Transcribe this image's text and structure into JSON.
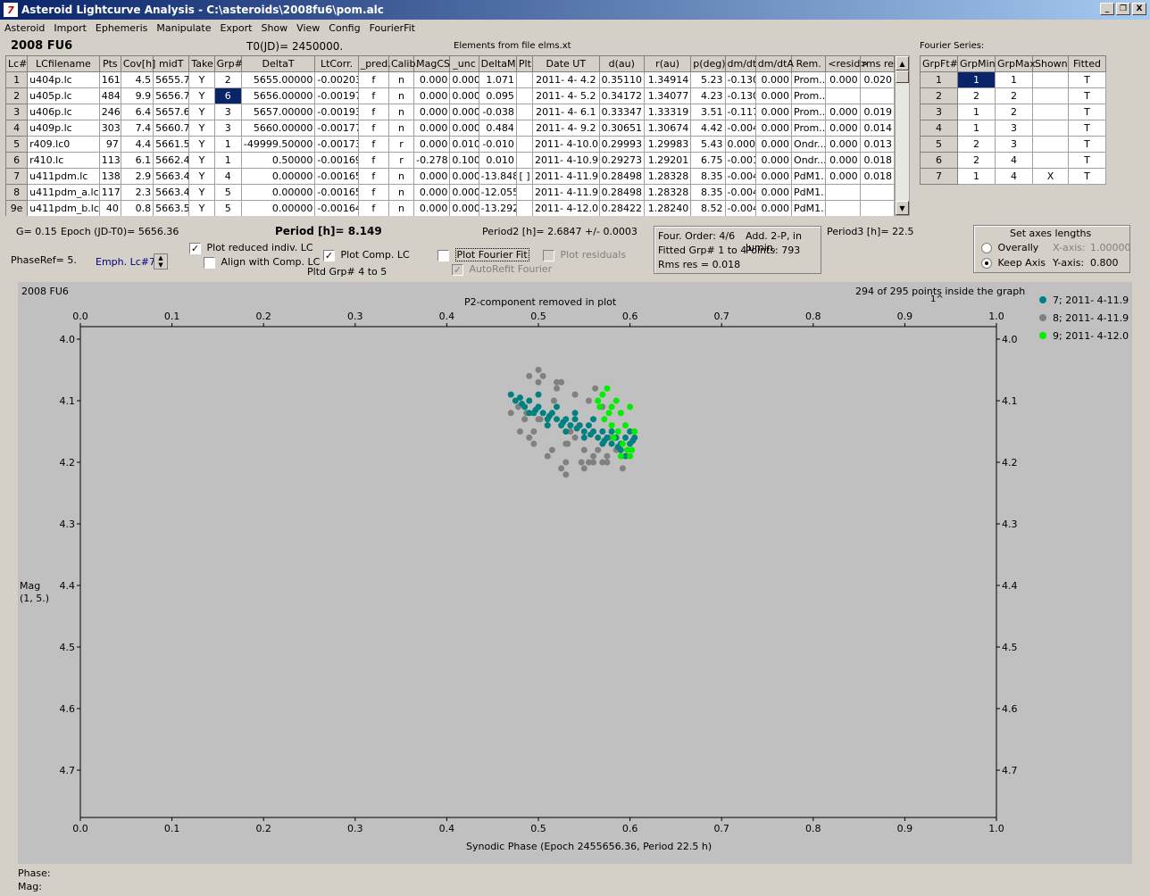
{
  "window": {
    "title": "Asteroid Lightcurve Analysis - C:\\asteroids\\2008fu6\\pom.alc",
    "icon_label": "7",
    "btn_min": "_",
    "btn_restore": "❐",
    "btn_close": "X"
  },
  "menu": [
    "Asteroid",
    "Import",
    "Ephemeris",
    "Manipulate",
    "Export",
    "Show",
    "View",
    "Config",
    "FourierFit"
  ],
  "header": {
    "asteroid": "2008 FU6",
    "t0": "T0(JD)= 2450000.",
    "elements": "Elements from file elms.xt",
    "fourier_series": "Fourier Series:"
  },
  "lc_table": {
    "columns": [
      "Lc#",
      "LCfilename",
      "Pts",
      "Cov[h]",
      "midT",
      "Take",
      "Grp#",
      "DeltaT",
      "LtCorr.",
      "_pred.",
      "Calib.",
      "MagCS",
      "_unc",
      "DeltaM",
      "Plt",
      "Date UT",
      "d(au)",
      "r(au)",
      "p(deg)",
      "dm/dt",
      "dm/dtA",
      "Rem.",
      "<resid>",
      "rms res"
    ],
    "rows": [
      [
        "1",
        "u404p.lc",
        "161",
        "4.5",
        "5655.7",
        "Y",
        "2",
        "5655.00000",
        "-0.00203",
        "f",
        "n",
        "0.000",
        "0.000",
        "1.071",
        "",
        "2011- 4- 4.2",
        "0.35110",
        "1.34914",
        "5.23",
        "-0.130",
        "0.000",
        "Prom...",
        "0.000",
        "0.020"
      ],
      [
        "2",
        "u405p.lc",
        "484",
        "9.9",
        "5656.7",
        "Y",
        "6",
        "5656.00000",
        "-0.00197",
        "f",
        "n",
        "0.000",
        "0.000",
        "0.095",
        "",
        "2011- 4- 5.2",
        "0.34172",
        "1.34077",
        "4.23",
        "-0.130",
        "0.000",
        "Prom...",
        "",
        ""
      ],
      [
        "3",
        "u406p.lc",
        "246",
        "6.4",
        "5657.6",
        "Y",
        "3",
        "5657.00000",
        "-0.00193",
        "f",
        "n",
        "0.000",
        "0.000",
        "-0.038",
        "",
        "2011- 4- 6.1",
        "0.33347",
        "1.33319",
        "3.51",
        "-0.117",
        "0.000",
        "Prom...",
        "0.000",
        "0.019"
      ],
      [
        "4",
        "u409p.lc",
        "303",
        "7.4",
        "5660.7",
        "Y",
        "3",
        "5660.00000",
        "-0.00177",
        "f",
        "n",
        "0.000",
        "0.000",
        "0.484",
        "",
        "2011- 4- 9.2",
        "0.30651",
        "1.30674",
        "4.42",
        "-0.004",
        "0.000",
        "Prom...",
        "0.000",
        "0.014"
      ],
      [
        "5",
        "r409.lc0",
        "97",
        "4.4",
        "5661.5",
        "Y",
        "1",
        "-49999.50000",
        "-0.00173",
        "f",
        "r",
        "0.000",
        "0.010",
        "-0.010",
        "",
        "2011- 4-10.0",
        "0.29993",
        "1.29983",
        "5.43",
        "0.000",
        "0.000",
        "Ondr...",
        "0.000",
        "0.013"
      ],
      [
        "6",
        "r410.lc",
        "113",
        "6.1",
        "5662.4",
        "Y",
        "1",
        "0.50000",
        "-0.00169",
        "f",
        "r",
        "-0.278",
        "0.100",
        "0.010",
        "",
        "2011- 4-10.9",
        "0.29273",
        "1.29201",
        "6.75",
        "-0.001",
        "0.000",
        "Ondr...",
        "0.000",
        "0.018"
      ],
      [
        "7",
        "u411pdm.lc",
        "138",
        "2.9",
        "5663.4",
        "Y",
        "4",
        "0.00000",
        "-0.00165",
        "f",
        "n",
        "0.000",
        "0.000",
        "-13.848",
        "[ ]",
        "2011- 4-11.9",
        "0.28498",
        "1.28328",
        "8.35",
        "-0.004",
        "0.000",
        "PdM1...",
        "0.000",
        "0.018"
      ],
      [
        "8",
        "u411pdm_a.lc",
        "117",
        "2.3",
        "5663.4",
        "Y",
        "5",
        "0.00000",
        "-0.00165",
        "f",
        "n",
        "0.000",
        "0.000",
        "-12.055",
        "",
        "2011- 4-11.9",
        "0.28498",
        "1.28328",
        "8.35",
        "-0.004",
        "0.000",
        "PdM1...",
        "",
        ""
      ],
      [
        "9e",
        "u411pdm_b.lc",
        "40",
        "0.8",
        "5663.5",
        "Y",
        "5",
        "0.00000",
        "-0.00164",
        "f",
        "n",
        "0.000",
        "0.000",
        "-13.292",
        "",
        "2011- 4-12.0",
        "0.28422",
        "1.28240",
        "8.52",
        "-0.004",
        "0.000",
        "PdM1...",
        "",
        ""
      ]
    ]
  },
  "fourier_table": {
    "columns": [
      "GrpFt#",
      "GrpMin",
      "GrpMax",
      "Shown",
      "Fitted"
    ],
    "rows": [
      [
        "1",
        "1",
        "1",
        "",
        "T"
      ],
      [
        "2",
        "2",
        "2",
        "",
        "T"
      ],
      [
        "3",
        "1",
        "2",
        "",
        "T"
      ],
      [
        "4",
        "1",
        "3",
        "",
        "T"
      ],
      [
        "5",
        "2",
        "3",
        "",
        "T"
      ],
      [
        "6",
        "2",
        "4",
        "",
        "T"
      ],
      [
        "7",
        "1",
        "4",
        "X",
        "T"
      ]
    ]
  },
  "controls": {
    "g": "G= 0.15",
    "epoch": "Epoch (JD-T0)= 5656.36",
    "phaseref": "PhaseRef= 5.",
    "emph": "Emph. Lc#7:",
    "plot_reduced": "Plot reduced indiv. LC",
    "align_comp": "Align with Comp. LC",
    "plot_comp": "Plot Comp. LC",
    "pltd_grp": "Pltd Grp#  4   to   5",
    "period": "Period [h]= 8.149",
    "period2": "Period2 [h]= 2.6847 +/- 0.0003",
    "plot_fourier": "Plot Fourier Fit",
    "autorefit": "AutoRefit Fourier",
    "plot_resid": "Plot residuals",
    "four_order": "Four. Order:  4/6",
    "add2p": "Add. 2-P, in lumin.",
    "fitted_grp": "Fitted Grp# 1 to 4",
    "points": "Points: 793",
    "rms": "Rms res     = 0.018",
    "period3": "Period3 [h]= 22.5",
    "axes_title": "Set axes lengths",
    "overally": "Overally",
    "keep_axis": "Keep Axis",
    "xaxis_label": "X-axis:",
    "xaxis_val": "1.00000",
    "yaxis_label": "Y-axis:",
    "yaxis_val": "0.800"
  },
  "plot": {
    "name": "2008 FU6",
    "p2note": "P2-component removed in plot",
    "inside": "294 of 295 points inside the graph",
    "inside2": "1^",
    "xlabel": "Synodic Phase (Epoch 2455656.36, Period 22.5 h)",
    "ylabel1": "Mag",
    "ylabel2": "(1, 5.)"
  },
  "chart_data": {
    "type": "scatter",
    "xlim": [
      0.0,
      1.0
    ],
    "ylim": [
      4.0,
      4.8
    ],
    "y_inverted": true,
    "x_ticks": [
      "0.0",
      "0.1",
      "0.2",
      "0.3",
      "0.4",
      "0.5",
      "0.6",
      "0.7",
      "0.8",
      "0.9",
      "1.0"
    ],
    "y_ticks": [
      "4.0",
      "4.1",
      "4.2",
      "4.3",
      "4.4",
      "4.5",
      "4.6",
      "4.7"
    ],
    "legend_position": "right",
    "series": [
      {
        "name": "7; 2011- 4-11.9",
        "color": "#008080",
        "x": [
          0.47,
          0.475,
          0.48,
          0.485,
          0.49,
          0.495,
          0.5,
          0.505,
          0.51,
          0.515,
          0.52,
          0.525,
          0.53,
          0.535,
          0.54,
          0.545,
          0.55,
          0.555,
          0.56,
          0.565,
          0.57,
          0.575,
          0.58,
          0.585,
          0.59,
          0.595,
          0.6,
          0.603,
          0.482,
          0.497,
          0.512,
          0.527,
          0.542,
          0.557,
          0.572,
          0.587,
          0.5,
          0.52,
          0.54,
          0.56,
          0.58,
          0.59,
          0.6,
          0.49,
          0.51,
          0.53,
          0.55,
          0.57,
          0.595,
          0.605
        ],
        "y": [
          4.09,
          4.1,
          4.095,
          4.11,
          4.1,
          4.12,
          4.11,
          4.12,
          4.13,
          4.12,
          4.13,
          4.14,
          4.13,
          4.14,
          4.13,
          4.14,
          4.15,
          4.14,
          4.15,
          4.16,
          4.15,
          4.16,
          4.17,
          4.16,
          4.17,
          4.16,
          4.17,
          4.165,
          4.105,
          4.115,
          4.125,
          4.135,
          4.145,
          4.155,
          4.165,
          4.175,
          4.09,
          4.11,
          4.12,
          4.13,
          4.15,
          4.18,
          4.15,
          4.12,
          4.14,
          4.15,
          4.16,
          4.17,
          4.19,
          4.16
        ]
      },
      {
        "name": "8; 2011- 4-11.9",
        "color": "#808080",
        "x": [
          0.47,
          0.478,
          0.485,
          0.49,
          0.495,
          0.5,
          0.505,
          0.51,
          0.515,
          0.52,
          0.525,
          0.53,
          0.535,
          0.54,
          0.545,
          0.55,
          0.555,
          0.56,
          0.565,
          0.57,
          0.575,
          0.48,
          0.495,
          0.51,
          0.525,
          0.54,
          0.555,
          0.57,
          0.585,
          0.49,
          0.5,
          0.52,
          0.53,
          0.56,
          0.575,
          0.487,
          0.502,
          0.517,
          0.532,
          0.547,
          0.562,
          0.577,
          0.592,
          0.5,
          0.53,
          0.55
        ],
        "y": [
          4.12,
          4.11,
          4.13,
          4.16,
          4.15,
          4.07,
          4.06,
          4.14,
          4.18,
          4.08,
          4.07,
          4.17,
          4.15,
          4.09,
          4.14,
          4.18,
          4.1,
          4.2,
          4.18,
          4.11,
          4.19,
          4.15,
          4.17,
          4.19,
          4.21,
          4.16,
          4.2,
          4.2,
          4.18,
          4.06,
          4.05,
          4.07,
          4.2,
          4.19,
          4.2,
          4.12,
          4.13,
          4.1,
          4.17,
          4.2,
          4.08,
          4.16,
          4.21,
          4.13,
          4.22,
          4.21
        ]
      },
      {
        "name": "9; 2011- 4-12.0",
        "color": "#00ee00",
        "x": [
          0.565,
          0.57,
          0.575,
          0.58,
          0.585,
          0.59,
          0.595,
          0.6,
          0.605,
          0.572,
          0.582,
          0.592,
          0.602,
          0.577,
          0.587,
          0.597,
          0.567,
          0.6,
          0.59,
          0.58
        ],
        "y": [
          4.1,
          4.09,
          4.08,
          4.11,
          4.1,
          4.12,
          4.14,
          4.11,
          4.15,
          4.13,
          4.16,
          4.17,
          4.18,
          4.12,
          4.15,
          4.18,
          4.11,
          4.19,
          4.19,
          4.14
        ]
      }
    ]
  }
}
